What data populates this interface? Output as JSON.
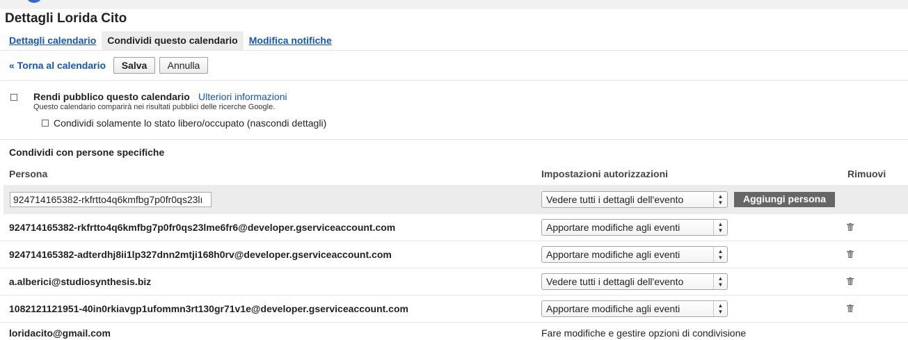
{
  "page": {
    "title": "Dettagli Lorida Cito"
  },
  "tabs": [
    {
      "label": "Dettagli calendario",
      "active": false
    },
    {
      "label": "Condividi questo calendario",
      "active": true
    },
    {
      "label": "Modifica notifiche",
      "active": false
    }
  ],
  "toolbar": {
    "back_label": "« Torna al calendario",
    "save_label": "Salva",
    "cancel_label": "Annulla"
  },
  "public": {
    "label": "Rendi pubblico questo calendario",
    "more_info": "Ulteriori informazioni",
    "note": "Questo calendario comparirà nei risultati pubblici delle ricerche Google.",
    "freebusy_label": "Condividi solamente lo stato libero/occupato (nascondi dettagli)"
  },
  "share": {
    "section_title": "Condividi con persone specifiche",
    "col_person": "Persona",
    "col_permission": "Impostazioni autorizzazioni",
    "col_remove": "Rimuovi",
    "input_value": "924714165382-rkfrtto4q6kmfbg7p0fr0qs23lı",
    "new_permission": "Vedere tutti i dettagli dell'evento",
    "add_button": "Aggiungi persona",
    "rows": [
      {
        "email": "924714165382-rkfrtto4q6kmfbg7p0fr0qs23lme6fr6@developer.gserviceaccount.com",
        "permission": "Apportare modifiche agli eventi"
      },
      {
        "email": "924714165382-adterdhj8ii1lp327dnn2mtji168h0rv@developer.gserviceaccount.com",
        "permission": "Apportare modifiche agli eventi"
      },
      {
        "email": "a.alberici@studiosynthesis.biz",
        "permission": "Vedere tutti i dettagli dell'evento"
      },
      {
        "email": "1082121121951-40in0rkiavgp1ufommn3rt130gr71v1e@developer.gserviceaccount.com",
        "permission": "Apportare modifiche agli eventi"
      }
    ],
    "owner": {
      "email": "loridacito@gmail.com",
      "permission": "Fare modifiche e gestire opzioni di condivisione"
    }
  },
  "colors": {
    "link": "#1155cc",
    "tab_active_bg": "#ececec",
    "add_button_bg": "#666666"
  },
  "icons": {
    "trash": "trash-icon",
    "select_arrows": "updown-arrows-icon"
  }
}
